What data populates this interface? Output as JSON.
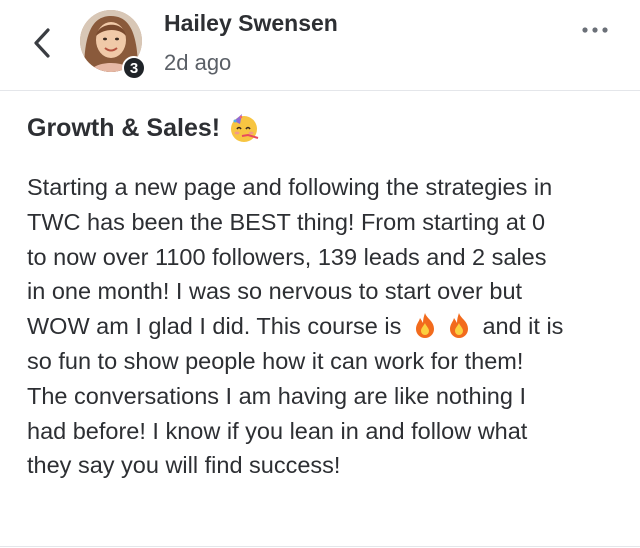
{
  "post": {
    "author": "Hailey Swensen",
    "badge_level": "3",
    "timestamp": "2d ago",
    "title": "Growth & Sales!",
    "title_emoji": "partying-face-emoji",
    "body_lines": [
      "Starting a new page and following the strategies in",
      "TWC has been the BEST thing! From starting at 0",
      "to now over 1100 followers, 139 leads and 2 sales",
      "in one month! I was so nervous to start over but",
      "WOW am I glad I did. This course is",
      "and it is",
      "so fun to show people how it can work for them!",
      "The conversations I am having are like nothing I",
      "had before! I know if you lean in and follow what",
      "they say you will find success!"
    ]
  },
  "icons": {
    "back": "chevron-left-icon",
    "more": "more-horizontal-icon",
    "fire": "fire-emoji"
  },
  "colors": {
    "text": "#2d2f33",
    "muted": "#5a5f66",
    "divider": "#e4e6ea",
    "badge": "#1f2328"
  }
}
